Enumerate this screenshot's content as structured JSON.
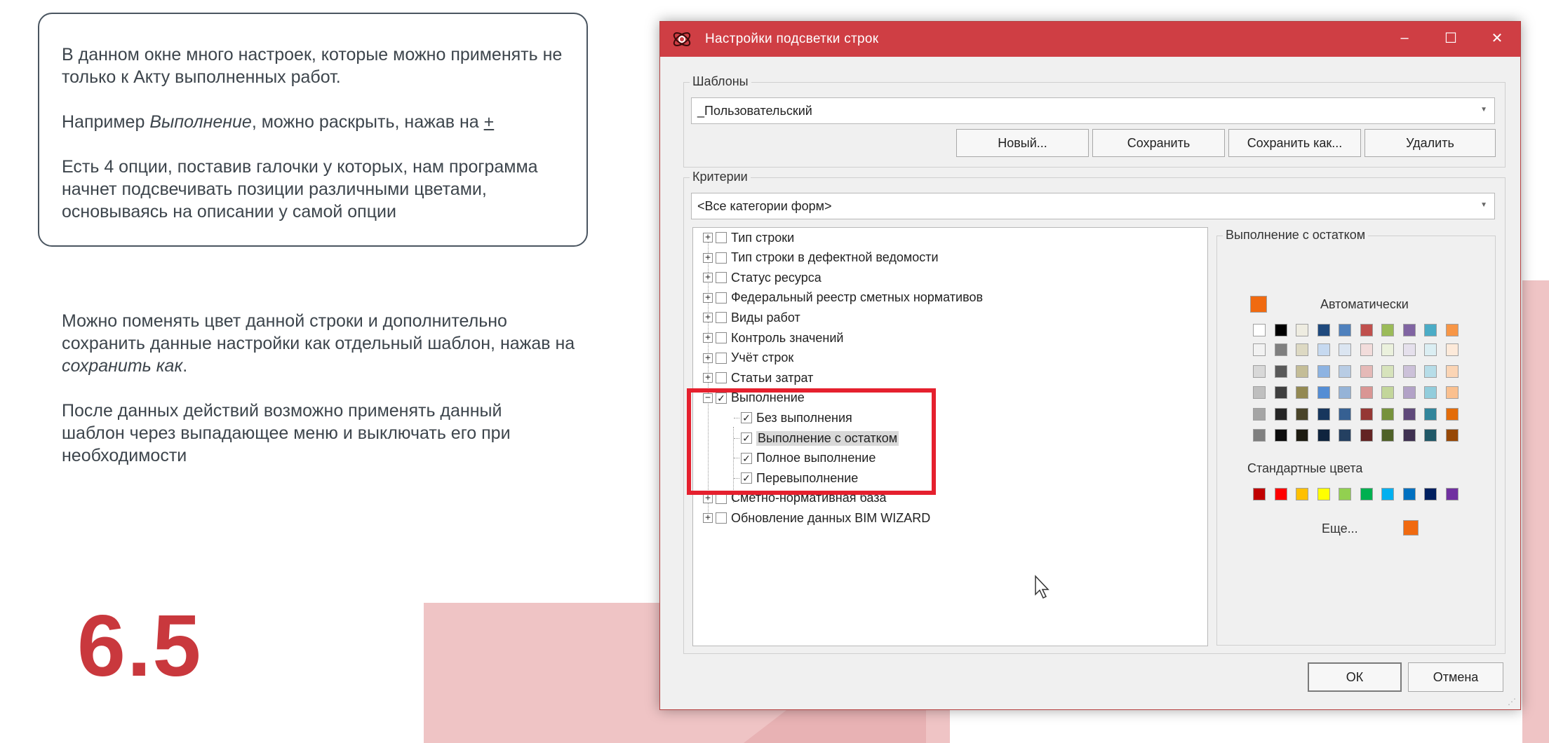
{
  "left": {
    "box_paragraphs": [
      {
        "text": "В данном окне много настроек, которые можно применять не только к Акту выполненных работ."
      },
      {
        "before": "Например ",
        "em": "Выполнение",
        "after": ", можно раскрыть, нажав на ",
        "plus": "+"
      },
      {
        "text": "Есть 4 опции, поставив галочки у которых, нам программа начнет подсвечивать позиции различными цветами, основываясь на описании у самой опции"
      }
    ],
    "lower_paragraph_1": {
      "before": "Можно поменять цвет данной строки и дополнительно сохранить данные настройки как отдельный шаблон, нажав на ",
      "em": "сохранить как",
      "after": "."
    },
    "lower_paragraph_2": "После данных действий возможно применять данный шаблон через выпадающее меню и выключать его при необходимости",
    "section_number": "6.5"
  },
  "dialog": {
    "title": "Настройки подсветки строк",
    "window_buttons": {
      "minimize": "–",
      "maximize": "☐",
      "close": "✕"
    },
    "templates": {
      "legend": "Шаблоны",
      "selected": "_Пользовательский",
      "buttons": {
        "new": "Новый...",
        "save": "Сохранить",
        "save_as": "Сохранить как...",
        "delete": "Удалить"
      }
    },
    "criteria": {
      "legend": "Критерии",
      "selected": "<Все категории форм>"
    },
    "tree": {
      "items": [
        {
          "label": "Тип строки",
          "expander": "+",
          "checked": ""
        },
        {
          "label": "Тип строки в дефектной ведомости",
          "expander": "+",
          "checked": ""
        },
        {
          "label": "Статус ресурса",
          "expander": "+",
          "checked": ""
        },
        {
          "label": "Федеральный реестр сметных нормативов",
          "expander": "+",
          "checked": ""
        },
        {
          "label": "Виды работ",
          "expander": "+",
          "checked": ""
        },
        {
          "label": "Контроль значений",
          "expander": "+",
          "checked": ""
        },
        {
          "label": "Учёт строк",
          "expander": "+",
          "checked": ""
        },
        {
          "label": "Статьи затрат",
          "expander": "+",
          "checked": ""
        },
        {
          "label": "Выполнение",
          "expander": "−",
          "checked": "✓"
        },
        {
          "label": "Сметно-нормативная база",
          "expander": "+",
          "checked": ""
        },
        {
          "label": "Обновление данных BIM WIZARD",
          "expander": "+",
          "checked": ""
        }
      ],
      "children": [
        {
          "label": "Без выполнения",
          "checked": "✓"
        },
        {
          "label": "Выполнение с остатком",
          "checked": "✓"
        },
        {
          "label": "Полное выполнение",
          "checked": "✓"
        },
        {
          "label": "Перевыполнение",
          "checked": "✓"
        }
      ]
    },
    "color_panel": {
      "legend": "Выполнение с остатком",
      "automatic_label": "Автоматически",
      "automatic_color": "#f06a10",
      "standard_label": "Стандартные цвета",
      "more_label": "Еще...",
      "current_color": "#f06a10",
      "theme_rows": [
        [
          "#ffffff",
          "#000000",
          "#eeece1",
          "#1f497d",
          "#4f81bd",
          "#c0504d",
          "#9bbb59",
          "#8064a2",
          "#4bacc6",
          "#f79646"
        ],
        [
          "#f2f2f2",
          "#7f7f7f",
          "#ddd9c3",
          "#c6d9f0",
          "#dbe5f1",
          "#f2dcdb",
          "#ebf1dd",
          "#e5e0ec",
          "#dbeef3",
          "#fdeada"
        ],
        [
          "#d8d8d8",
          "#595959",
          "#c4bd97",
          "#8db3e2",
          "#b8cce4",
          "#e5b9b7",
          "#d7e3bc",
          "#ccc1d9",
          "#b7dde8",
          "#fbd5b5"
        ],
        [
          "#bfbfbf",
          "#3f3f3f",
          "#938953",
          "#548dd4",
          "#95b3d7",
          "#d99694",
          "#c3d69b",
          "#b2a2c7",
          "#92cddc",
          "#fac08f"
        ],
        [
          "#a5a5a5",
          "#262626",
          "#494429",
          "#17365d",
          "#366092",
          "#953734",
          "#76923c",
          "#5f497a",
          "#31859b",
          "#e36c09"
        ],
        [
          "#7f7f7f",
          "#0c0c0c",
          "#1d1b10",
          "#0f243e",
          "#244061",
          "#632423",
          "#4f6128",
          "#3f3151",
          "#205867",
          "#974806"
        ]
      ],
      "standard_colors": [
        "#c00000",
        "#ff0000",
        "#ffc000",
        "#ffff00",
        "#92d050",
        "#00b050",
        "#00b0f0",
        "#0070c0",
        "#002060",
        "#7030a0"
      ]
    },
    "footer": {
      "ok": "ОК",
      "cancel": "Отмена"
    }
  },
  "colors": {
    "accent": "#c9383d",
    "titlebar": "#cf3e44",
    "highlight": "#e5202e",
    "background_shape": "#efc4c5"
  }
}
